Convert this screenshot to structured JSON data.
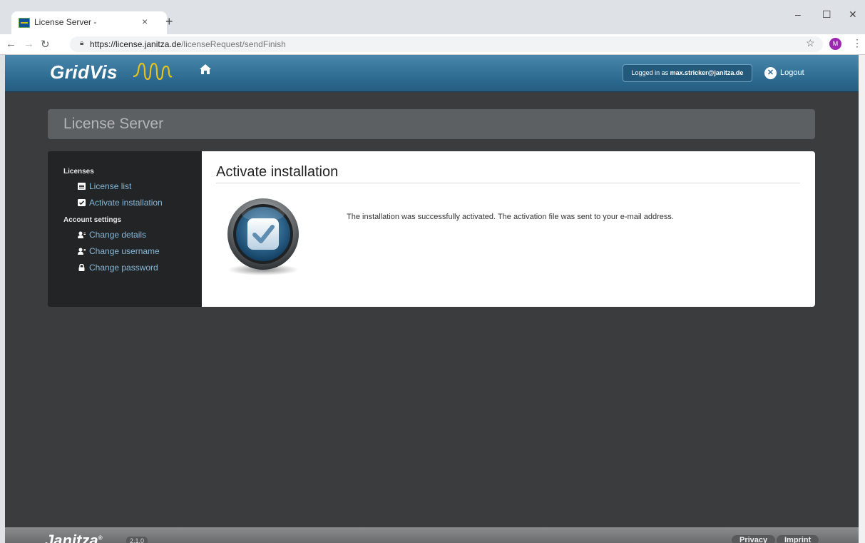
{
  "browser": {
    "tab_title": "License Server -",
    "tab_close": "×",
    "new_tab": "+",
    "url_host": "https://license.janitza.de",
    "url_path": "/licenseRequest/sendFinish",
    "profile_initial": "M",
    "window_minimize": "–",
    "window_maximize": "☐",
    "window_close": "✕"
  },
  "header": {
    "logo_text": "GridVis",
    "logged_in_prefix": "Logged in as",
    "user_email": "max.stricker@janitza.de",
    "logout_label": "Logout"
  },
  "page": {
    "title": "License Server"
  },
  "sidebar": {
    "licenses_heading": "Licenses",
    "license_list": "License list",
    "activate_installation": "Activate installation",
    "account_heading": "Account settings",
    "change_details": "Change details",
    "change_username": "Change username",
    "change_password": "Change password"
  },
  "content": {
    "heading": "Activate installation",
    "message": "The installation was successfully activated. The activation file was sent to your e-mail address."
  },
  "footer": {
    "logo_text": "Janitza",
    "trademark": "®",
    "version": "2.1.0",
    "privacy": "Privacy",
    "imprint": "Imprint"
  },
  "colors": {
    "header_blue": "#2f6d93",
    "link_blue": "#85b8d8",
    "background": "#3a3c3e"
  },
  "icons": [
    "home-icon",
    "logout-icon",
    "list-icon",
    "checkbox-icon",
    "user-icon",
    "lock-icon",
    "success-check-icon"
  ]
}
